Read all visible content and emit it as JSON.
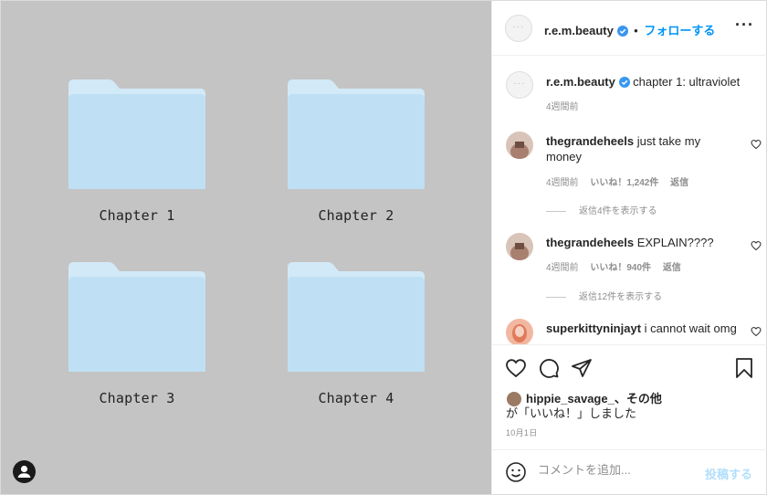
{
  "media": {
    "folders": [
      {
        "label": "Chapter 1"
      },
      {
        "label": "Chapter 2"
      },
      {
        "label": "Chapter 3"
      },
      {
        "label": "Chapter 4"
      }
    ],
    "folder_color": "#bfe0f4",
    "folder_tab_color": "#d2e9f7",
    "background": "#c4c4c4"
  },
  "header": {
    "username": "r.e.m.beauty",
    "separator": "•",
    "follow_label": "フォローする",
    "more_icon": "more-options-icon"
  },
  "caption": {
    "username": "r.e.m.beauty",
    "text": "chapter 1: ultraviolet",
    "time": "4週間前"
  },
  "comments": [
    {
      "username": "thegrandeheels",
      "text": "just take my money",
      "time": "4週間前",
      "likes": "いいね！1,242件",
      "reply_label": "返信",
      "view_replies": "返信4件を表示する"
    },
    {
      "username": "thegrandeheels",
      "text": "EXPLAIN????",
      "time": "4週間前",
      "likes": "いいね！940件",
      "reply_label": "返信",
      "view_replies": "返信12件を表示する"
    },
    {
      "username": "superkittyninjayt",
      "text": "i cannot wait omg"
    }
  ],
  "likes": {
    "username": "hippie_savage_",
    "suffix": "、その他",
    "line2": "が「いいね！」しました"
  },
  "date": "10月1日",
  "comment_box": {
    "placeholder": "コメントを追加...",
    "post_label": "投稿する"
  },
  "colors": {
    "accent": "#0095f6",
    "verified": "#3897f0",
    "post_disabled": "#b2dffc"
  }
}
